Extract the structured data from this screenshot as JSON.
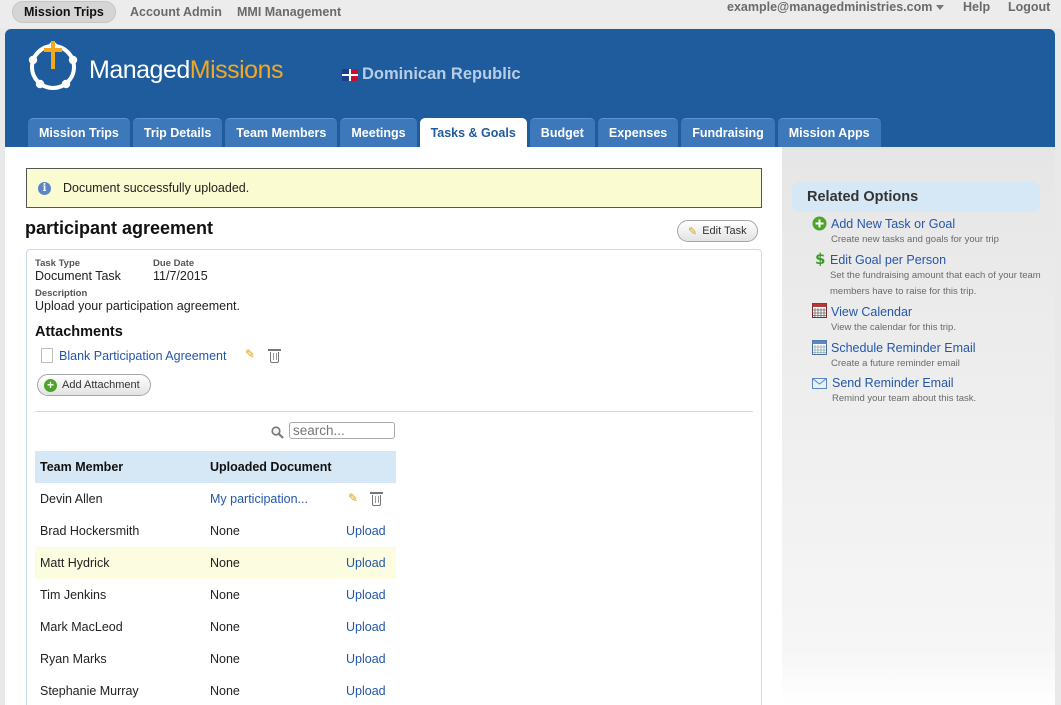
{
  "topnav": {
    "mission_trips": "Mission Trips",
    "account_admin": "Account Admin",
    "mmi_management": "MMI Management",
    "user_email": "example@managedministries.com",
    "help": "Help",
    "logout": "Logout"
  },
  "brand": {
    "part1": "Managed",
    "part2": "Missions",
    "accent_color": "#f4a81d",
    "header_color": "#1f5c9d"
  },
  "country": "Dominican Republic",
  "tabs": [
    {
      "label": "Mission Trips"
    },
    {
      "label": "Trip Details"
    },
    {
      "label": "Team Members"
    },
    {
      "label": "Meetings"
    },
    {
      "label": "Tasks & Goals"
    },
    {
      "label": "Budget"
    },
    {
      "label": "Expenses"
    },
    {
      "label": "Fundraising"
    },
    {
      "label": "Mission Apps"
    }
  ],
  "alert": "Document successfully uploaded.",
  "task": {
    "title": "participant agreement",
    "edit_label": "Edit Task",
    "type_label": "Task Type",
    "type_value": "Document Task",
    "due_label": "Due Date",
    "due_value": "11/7/2015",
    "desc_label": "Description",
    "desc_value": "Upload your participation agreement."
  },
  "attachments": {
    "heading": "Attachments",
    "file": "Blank Participation Agreement",
    "add_label": "Add Attachment"
  },
  "search": {
    "placeholder": "search..."
  },
  "table": {
    "headers": [
      "Team Member",
      "Uploaded Document"
    ],
    "rows": [
      {
        "name": "Devin Allen",
        "doc": "My participation...",
        "action": ""
      },
      {
        "name": "Brad Hockersmith",
        "doc": "None",
        "action": "Upload"
      },
      {
        "name": "Matt Hydrick",
        "doc": "None",
        "action": "Upload"
      },
      {
        "name": "Tim Jenkins",
        "doc": "None",
        "action": "Upload"
      },
      {
        "name": "Mark MacLeod",
        "doc": "None",
        "action": "Upload"
      },
      {
        "name": "Ryan Marks",
        "doc": "None",
        "action": "Upload"
      },
      {
        "name": "Stephanie Murray",
        "doc": "None",
        "action": "Upload"
      }
    ]
  },
  "sidebar": {
    "heading": "Related Options",
    "items": [
      {
        "label": "Add New Task or Goal",
        "desc": "Create new tasks and goals for your trip",
        "icon": "add-icon"
      },
      {
        "label": "Edit Goal per Person",
        "desc": "Set the fundraising amount that each of your team members have to raise for this trip.",
        "icon": "dollar-icon"
      },
      {
        "label": "View Calendar",
        "desc": "View the calendar for this trip.",
        "icon": "calendar-icon"
      },
      {
        "label": "Schedule Reminder Email",
        "desc": "Create a future reminder email",
        "icon": "schedule-icon"
      },
      {
        "label": "Send Reminder Email",
        "desc": "Remind your team about this task.",
        "icon": "envelope-icon"
      }
    ]
  }
}
